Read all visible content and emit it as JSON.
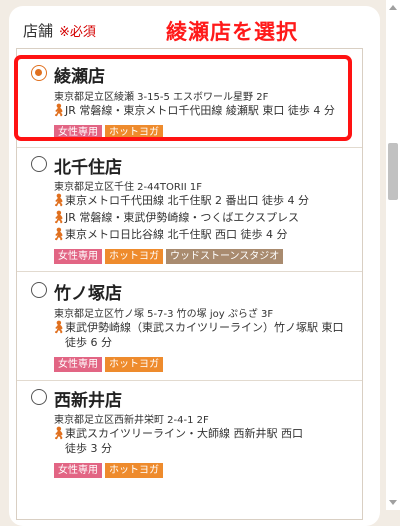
{
  "field": {
    "label": "店舗",
    "required": "※必須"
  },
  "annotation": "綾瀬店を選択",
  "colors": {
    "accent": "#e0701f",
    "tag_pink": "#e26584",
    "tag_orange": "#ee8b2d",
    "tag_brown": "#a98b6f",
    "highlight": "#ff1212"
  },
  "stores": [
    {
      "name": "綾瀬店",
      "selected": true,
      "address": "東京都足立区綾瀬 3-15-5 エスボワール星野 2F",
      "routes": [
        "JR 常磐線・東京メトロ千代田線 綾瀬駅 東口 徒歩 4 分"
      ],
      "tags": [
        "女性専用",
        "ホットヨガ"
      ]
    },
    {
      "name": "北千住店",
      "selected": false,
      "address": "東京都足立区千住 2-44TORII 1F",
      "routes": [
        "東京メトロ千代田線 北千住駅 2 番出口 徒歩 4 分",
        "JR 常磐線・東武伊勢崎線・つくばエクスプレス",
        "東京メトロ日比谷線 北千住駅 西口 徒歩 4 分"
      ],
      "tags": [
        "女性専用",
        "ホットヨガ",
        "ウッドストーンスタジオ"
      ]
    },
    {
      "name": "竹ノ塚店",
      "selected": false,
      "address": "東京都足立区竹ノ塚 5-7-3 竹の塚 joy ぷらざ 3F",
      "routes": [
        "東武伊勢崎線（東武スカイツリーライン）竹ノ塚駅 東口",
        "徒歩 6 分"
      ],
      "tags": [
        "女性専用",
        "ホットヨガ"
      ]
    },
    {
      "name": "西新井店",
      "selected": false,
      "address": "東京都足立区西新井栄町 2-4-1 2F",
      "routes": [
        "東武スカイツリーライン・大師線 西新井駅 西口",
        "徒歩 3 分"
      ],
      "tags": [
        "女性専用",
        "ホットヨガ"
      ]
    }
  ]
}
